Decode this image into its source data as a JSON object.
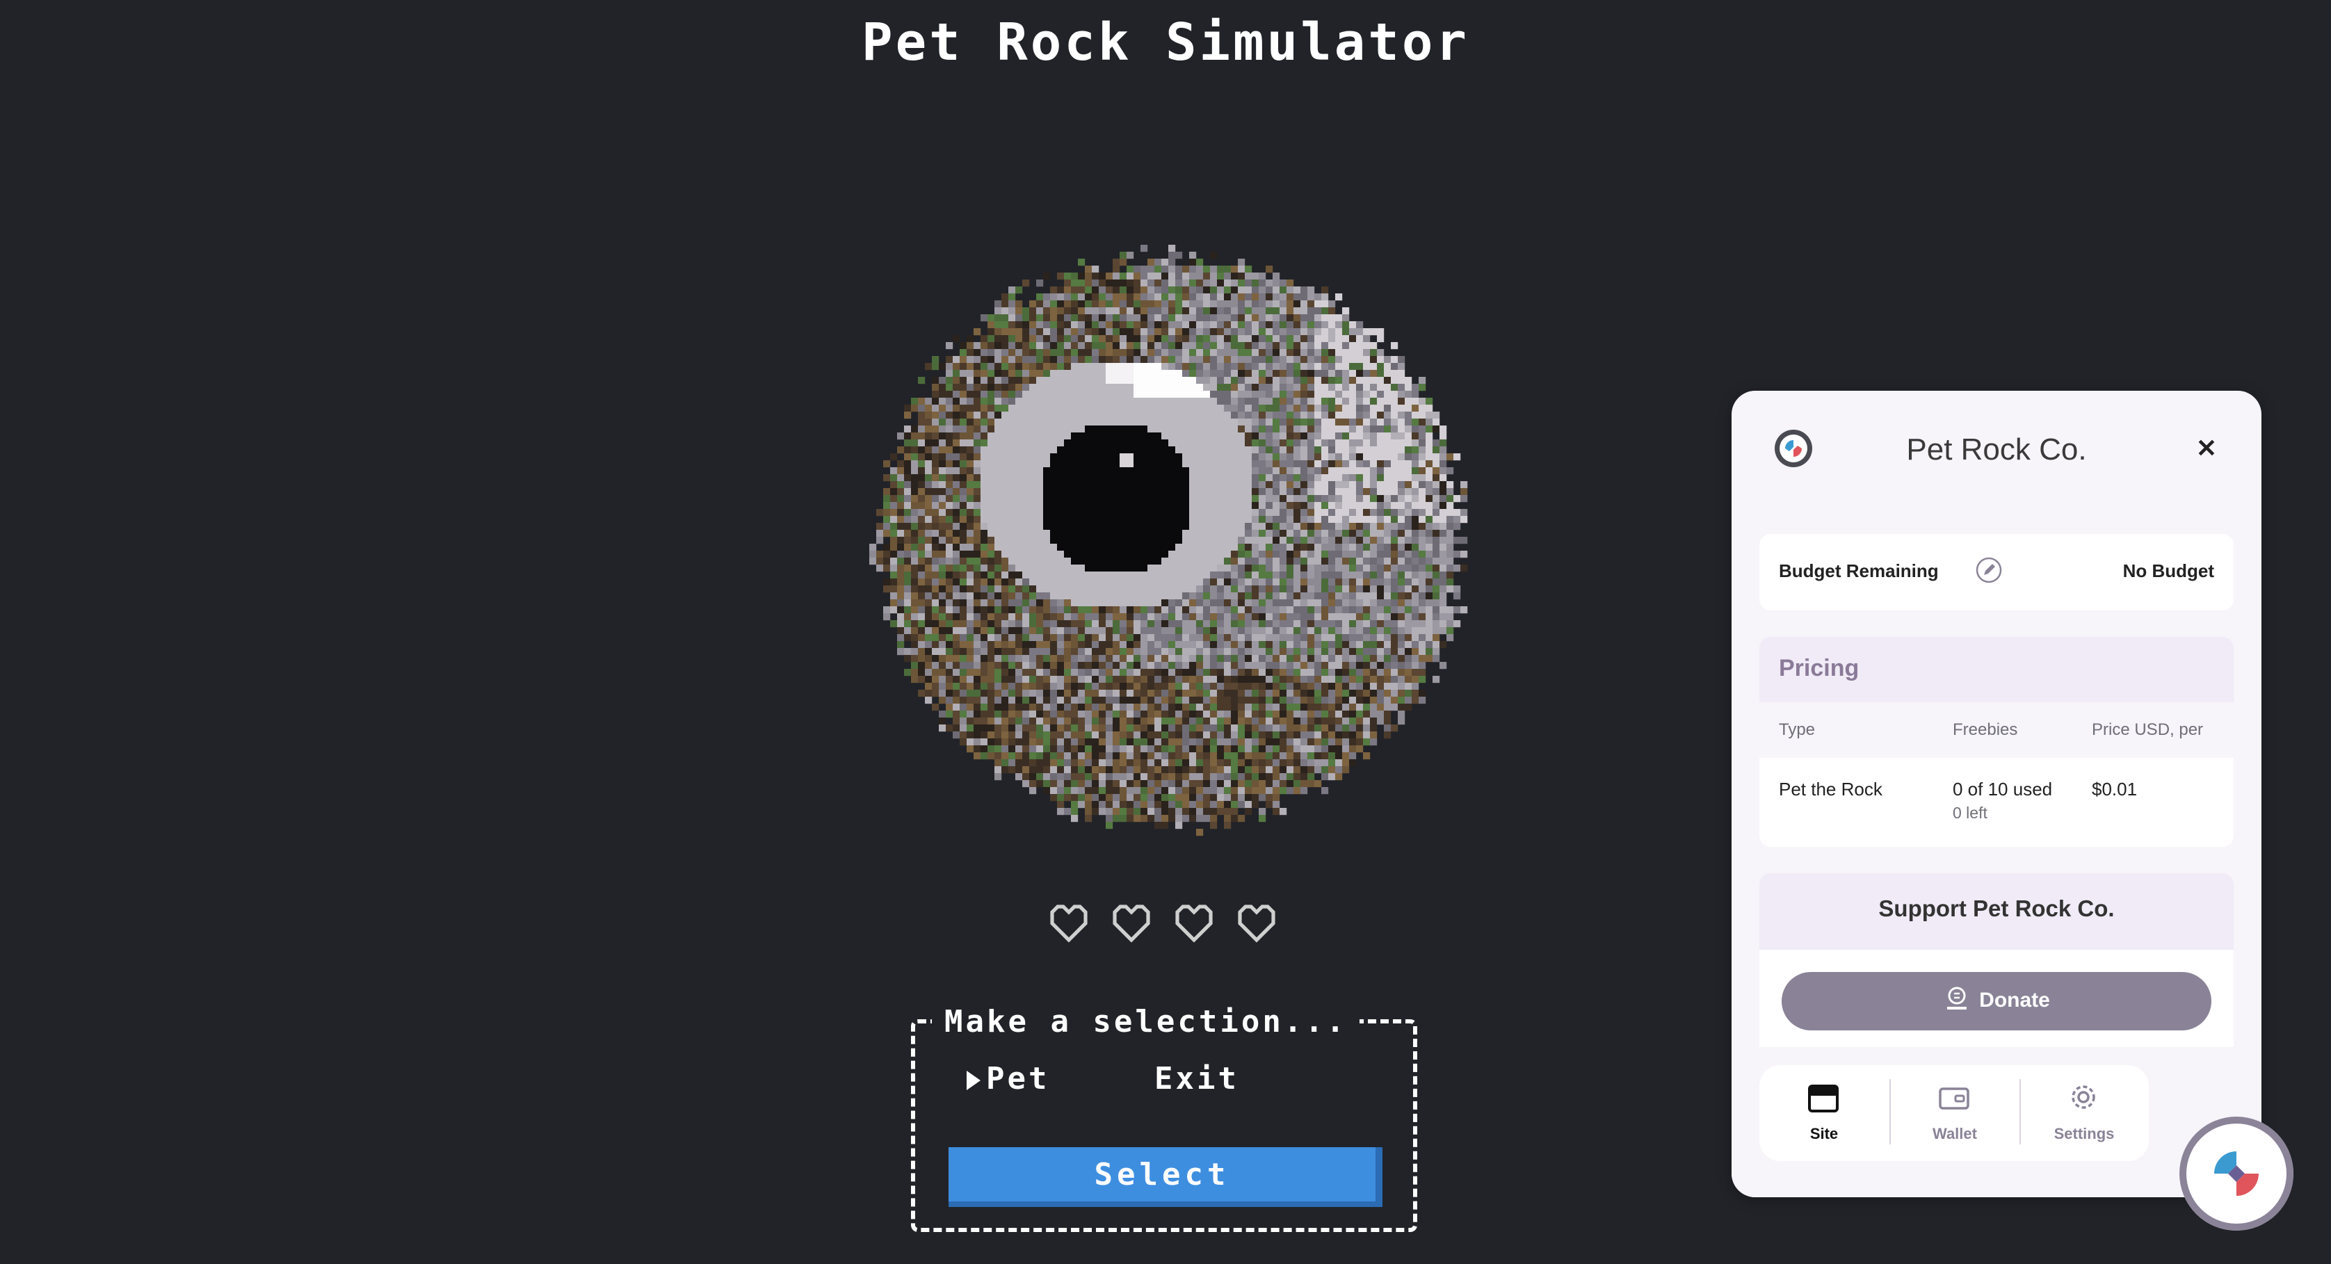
{
  "game": {
    "title": "Pet Rock Simulator",
    "hearts_filled": 0,
    "hearts_total": 4,
    "menu_title": "Make a selection...",
    "options": [
      "Pet",
      "Exit"
    ],
    "selected_option": "Pet",
    "select_label": "Select",
    "colors": {
      "background": "#212328",
      "select_button": "#3e8ee0",
      "text": "#ffffff"
    }
  },
  "panel": {
    "title": "Pet Rock Co.",
    "close_icon": "close-icon",
    "budget": {
      "label": "Budget Remaining",
      "value": "No Budget",
      "edit_icon": "pencil-icon"
    },
    "pricing": {
      "title": "Pricing",
      "columns": [
        "Type",
        "Freebies",
        "Price USD, per"
      ],
      "rows": [
        {
          "type": "Pet the Rock",
          "freebies": "0 of 10 used",
          "freebies_sub": "0 left",
          "price": "$0.01"
        }
      ]
    },
    "support": {
      "title": "Support Pet Rock Co.",
      "donate_label": "Donate",
      "donate_icon": "coin-hand-icon"
    },
    "tabs": [
      {
        "label": "Site",
        "icon": "browser-window-icon",
        "active": true
      },
      {
        "label": "Wallet",
        "icon": "wallet-icon",
        "active": false
      },
      {
        "label": "Settings",
        "icon": "gear-icon",
        "active": false
      }
    ],
    "colors": {
      "accent": "#8a8397",
      "header_bg": "#f0ebf6",
      "panel_bg": "#f7f4fa"
    }
  }
}
